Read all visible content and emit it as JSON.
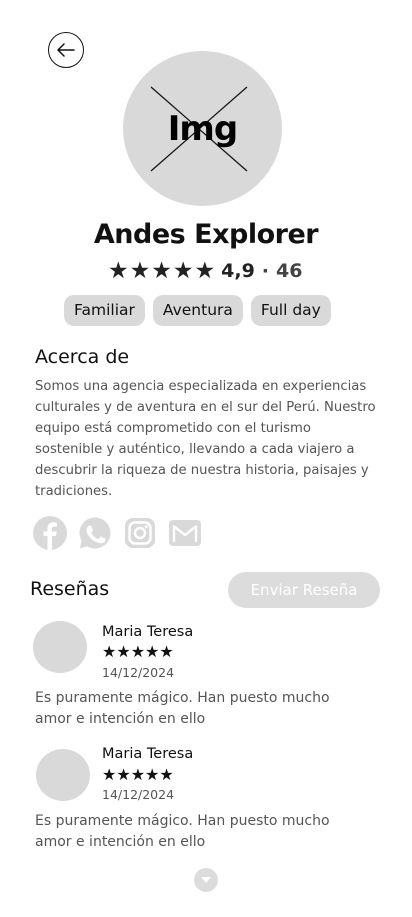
{
  "header": {
    "back_icon": "arrow-left-icon",
    "avatar_placeholder": "Img"
  },
  "agency": {
    "name": "Andes Explorer",
    "rating": "4,9",
    "separator": "·",
    "review_count": "46",
    "stars": 5
  },
  "tags": [
    "Familiar",
    "Aventura",
    "Full day"
  ],
  "about": {
    "title": "Acerca de",
    "text": "Somos una agencia especializada en experiencias culturales y de aventura en el sur del Perú. Nuestro equipo está comprometido con el turismo sostenible y auténtico, llevando a cada viajero a descubrir la riqueza de nuestra historia, paisajes y tradiciones."
  },
  "socials": [
    "facebook-icon",
    "whatsapp-icon",
    "instagram-icon",
    "mail-icon"
  ],
  "reviews": {
    "title": "Reseñas",
    "send_label": "Enviar Reseña",
    "items": [
      {
        "name": "Maria Teresa",
        "stars": "★★★★★",
        "date": "14/12/2024",
        "text": "Es puramente mágico. Han puesto mucho amor e intención en ello"
      },
      {
        "name": "Maria Teresa",
        "stars": "★★★★★",
        "date": "14/12/2024",
        "text": "Es puramente mágico. Han puesto mucho amor e intención en ello"
      }
    ]
  },
  "colors": {
    "placeholder_gray": "#d9d9d9",
    "text_dark": "#111111",
    "text_muted": "#555555"
  }
}
